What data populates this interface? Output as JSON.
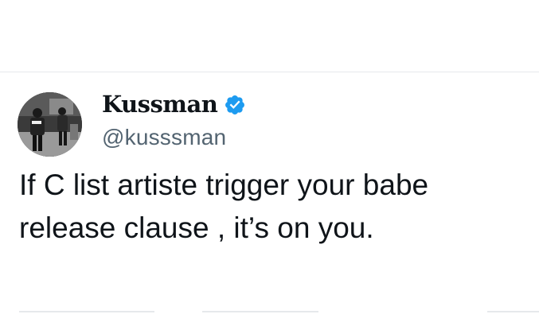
{
  "tweet": {
    "author": {
      "display_name": "Kussman",
      "handle": "@kusssman",
      "verified": true,
      "verified_color": "#1d9bf0"
    },
    "text_lines": [
      "If C list artiste trigger your babe",
      "release clause , it’s on you."
    ]
  },
  "icons": {
    "verified": "verified-badge-icon",
    "avatar": "profile-photo"
  }
}
